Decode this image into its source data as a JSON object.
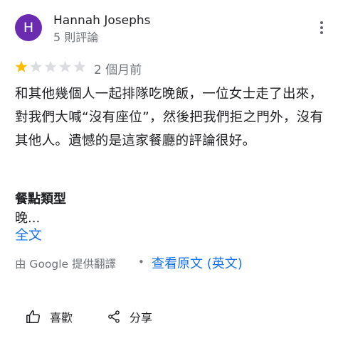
{
  "review": {
    "avatar_letter": "H",
    "avatar_color": "#6a2bb0",
    "author_name": "Hannah Josephs",
    "author_review_count": "5 則評論",
    "rating": 1,
    "max_rating": 5,
    "star_fill_color": "#fbbc04",
    "star_empty_color": "#dadce0",
    "time_ago": "2 個月前",
    "text": "和其他幾個人一起排隊吃晚飯，一位女士走了出來，對我們大喊“沒有座位”，然後把我們拒之門外，沒有其他人。遺憾的是這家餐廳的評論很好。",
    "section_title": "餐點類型",
    "section_value": "晚...",
    "more_link": "全文",
    "translated_by": "由 Google 提供翻譯",
    "separator": "•",
    "original_link": "查看原文 (英文)"
  },
  "actions": {
    "like_label": "喜歡",
    "share_label": "分享"
  },
  "icons": {
    "menu": "more-vert-icon",
    "like": "thumbs-up-icon",
    "share": "share-icon",
    "star": "star-icon"
  }
}
